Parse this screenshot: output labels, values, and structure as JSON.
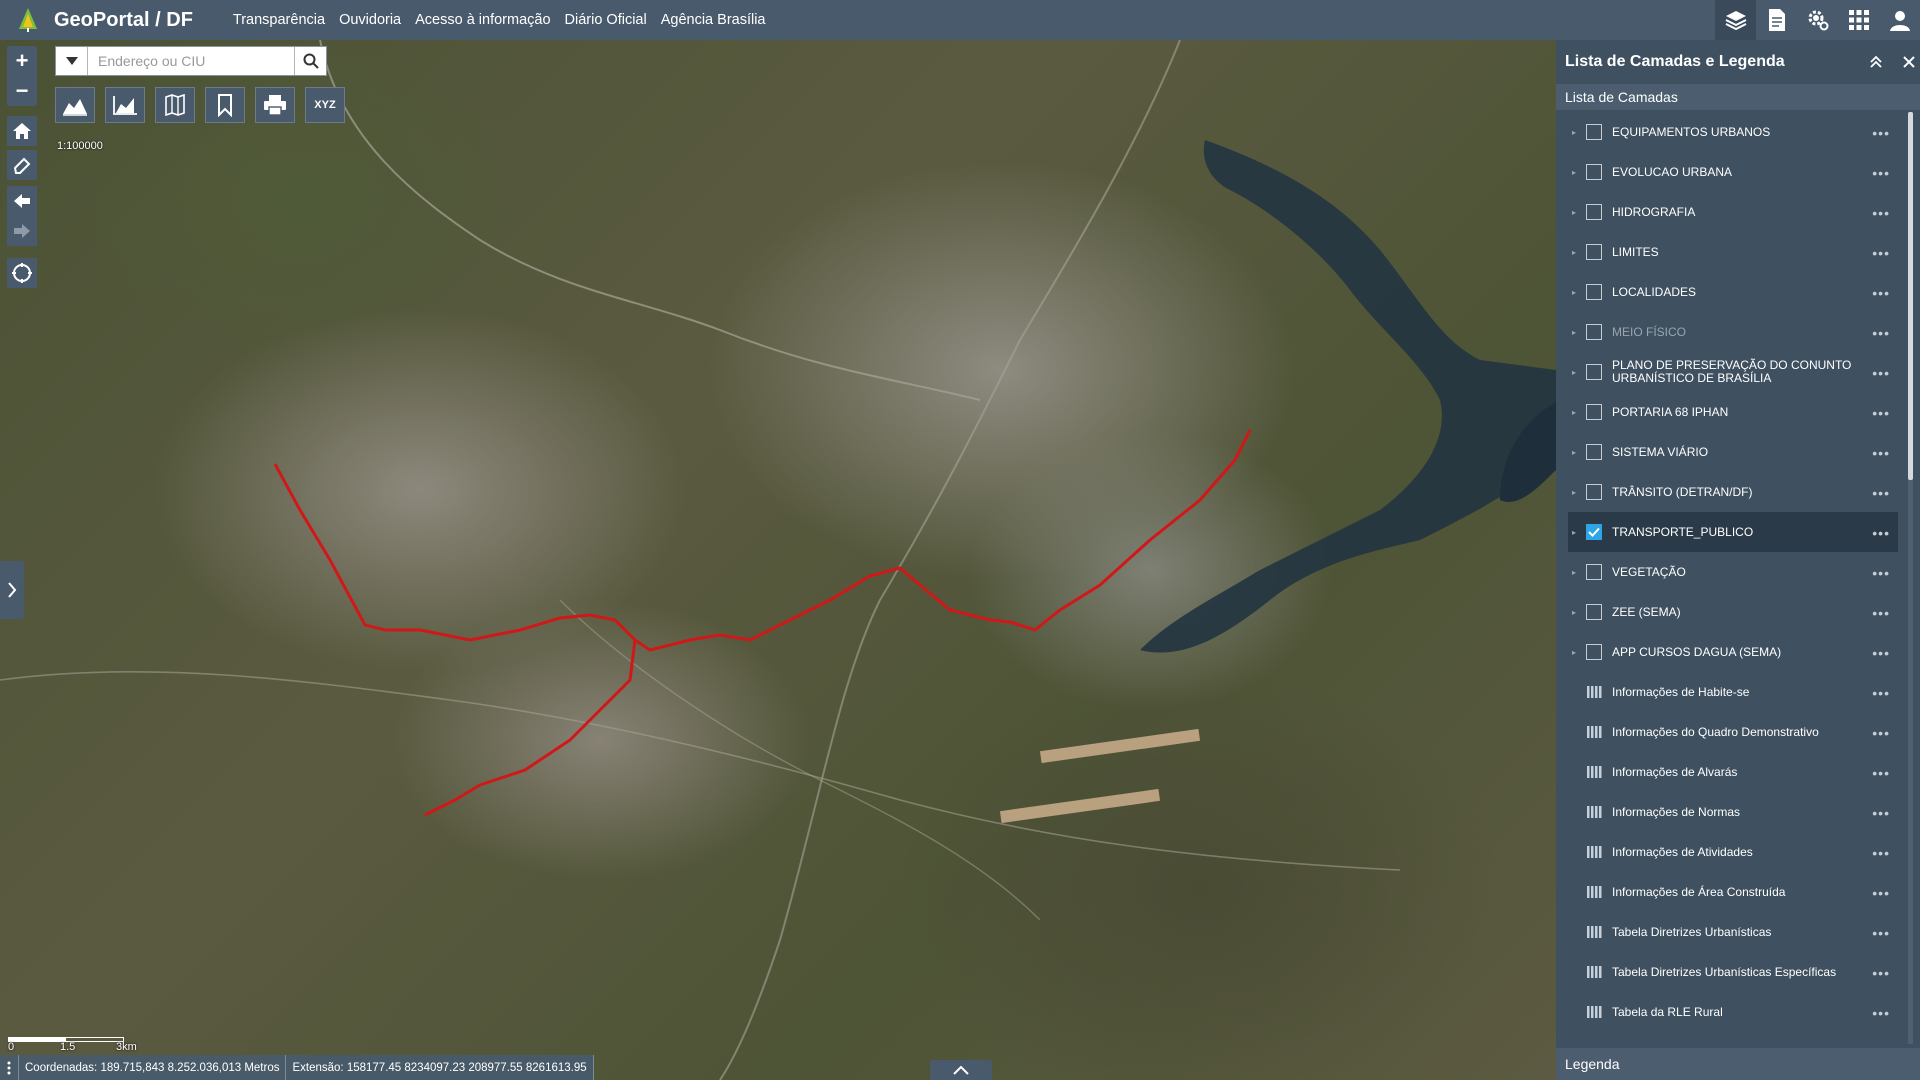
{
  "header": {
    "title": "GeoPortal / DF",
    "nav": [
      "Transparência",
      "Ouvidoria",
      "Acesso à informação",
      "Diário Oficial",
      "Agência Brasília"
    ]
  },
  "icons": {
    "logo": "tree-logo",
    "top_right": [
      "layers-icon",
      "document-icon",
      "settings-icon",
      "apps-grid-icon",
      "user-icon"
    ],
    "tools": [
      "elevation-profile-icon",
      "area-chart-icon",
      "map-swipe-icon",
      "bookmark-icon",
      "print-icon",
      "xyz-coordinates-icon"
    ]
  },
  "map": {
    "search": {
      "placeholder": "Endereço ou CIU"
    },
    "tool_xyz_label": "XYZ",
    "scale": "1:100000",
    "scalebar": {
      "zero": "0",
      "mid": "1.5",
      "end": "3km"
    },
    "coordinates": "Coordenadas: 189.715,843 8.252.036,013 Metros",
    "extent": "Extensão: 158177.45 8234097.23 208977.55 8261613.95"
  },
  "panel": {
    "title": "Lista de Camadas e Legenda",
    "subtitle": "Lista de Camadas",
    "legend": "Legenda",
    "layers": [
      {
        "label": "EQUIPAMENTOS URBANOS",
        "type": "group",
        "checked": false
      },
      {
        "label": "EVOLUCAO URBANA",
        "type": "group",
        "checked": false
      },
      {
        "label": "HIDROGRAFIA",
        "type": "group",
        "checked": false
      },
      {
        "label": "LIMITES",
        "type": "group",
        "checked": false
      },
      {
        "label": "LOCALIDADES",
        "type": "group",
        "checked": false
      },
      {
        "label": "MEIO FÍSICO",
        "type": "group",
        "checked": false,
        "dim": true
      },
      {
        "label": "PLANO DE PRESERVAÇÃO DO CONUNTO URBANÍSTICO DE BRASÍLIA",
        "type": "group",
        "checked": false
      },
      {
        "label": "PORTARIA 68 IPHAN",
        "type": "group",
        "checked": false
      },
      {
        "label": "SISTEMA VIÁRIO",
        "type": "group",
        "checked": false
      },
      {
        "label": "TRÂNSITO (DETRAN/DF)",
        "type": "group",
        "checked": false
      },
      {
        "label": "TRANSPORTE_PUBLICO",
        "type": "group",
        "checked": true,
        "selected": true
      },
      {
        "label": "VEGETAÇÃO",
        "type": "group",
        "checked": false
      },
      {
        "label": "ZEE (SEMA)",
        "type": "group",
        "checked": false
      },
      {
        "label": "APP CURSOS DAGUA (SEMA)",
        "type": "group",
        "checked": false
      },
      {
        "label": "Informações de Habite-se",
        "type": "table"
      },
      {
        "label": "Informações do Quadro Demonstrativo",
        "type": "table"
      },
      {
        "label": "Informações de Alvarás",
        "type": "table"
      },
      {
        "label": "Informações de Normas",
        "type": "table"
      },
      {
        "label": "Informações de Atividades",
        "type": "table"
      },
      {
        "label": "Informações de Área Construída",
        "type": "table"
      },
      {
        "label": "Tabela Diretrizes Urbanísticas",
        "type": "table"
      },
      {
        "label": "Tabela Diretrizes Urbanísticas Específicas",
        "type": "table"
      },
      {
        "label": "Tabela da RLE Rural",
        "type": "table"
      }
    ]
  },
  "colors": {
    "topbar": "#485a6c",
    "panel": "#3f5060",
    "accent": "#2fa4e7",
    "route": "#d01818"
  }
}
